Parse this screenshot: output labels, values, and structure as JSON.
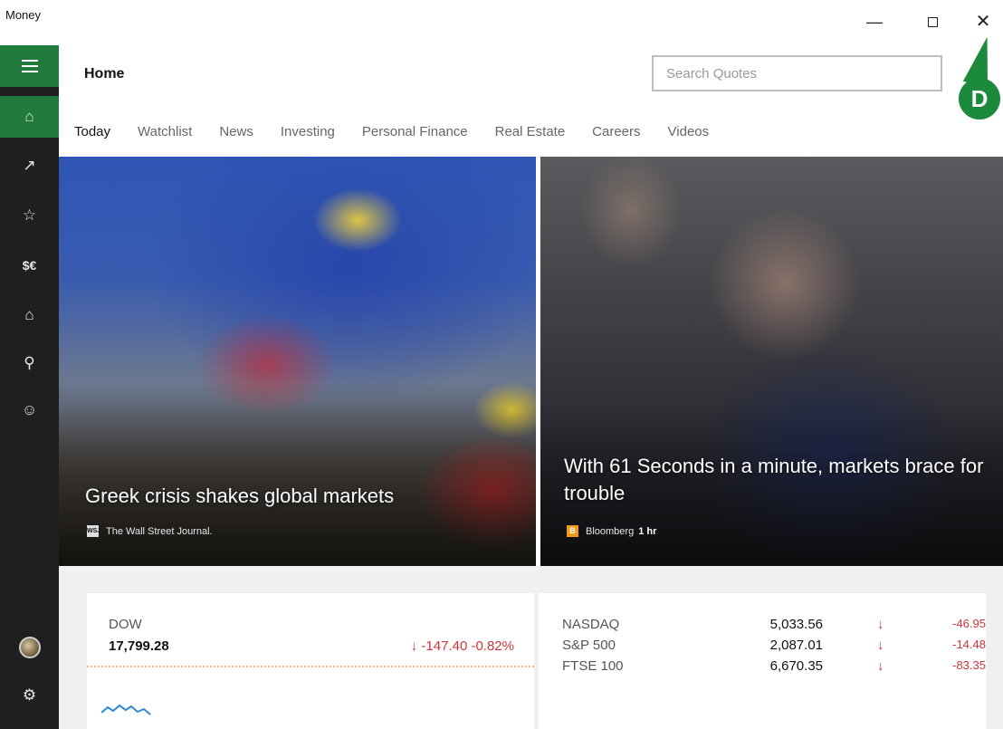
{
  "window": {
    "app_name": "Money",
    "minimize_glyph": "—",
    "close_glyph": "✕"
  },
  "rail": {
    "items": [
      {
        "name": "home",
        "icon": "home-icon",
        "glyph": "⌂"
      },
      {
        "name": "markets",
        "icon": "trend-up-icon",
        "glyph": "↗"
      },
      {
        "name": "watchlist",
        "icon": "star-icon",
        "glyph": "☆"
      },
      {
        "name": "currencies",
        "icon": "currency-icon",
        "glyph": "$€"
      },
      {
        "name": "mortgage",
        "icon": "house-dollar-icon",
        "glyph": "⌂"
      },
      {
        "name": "news",
        "icon": "news-icon",
        "glyph": "⚲"
      },
      {
        "name": "feedback",
        "icon": "smiley-icon",
        "glyph": "☺"
      },
      {
        "name": "settings",
        "icon": "gear-icon",
        "glyph": "⚙"
      }
    ]
  },
  "header": {
    "title": "Home",
    "search_placeholder": "Search Quotes"
  },
  "annotation": {
    "label": "D"
  },
  "tabs": [
    {
      "label": "Today",
      "active": true
    },
    {
      "label": "Watchlist",
      "active": false
    },
    {
      "label": "News",
      "active": false
    },
    {
      "label": "Investing",
      "active": false
    },
    {
      "label": "Personal Finance",
      "active": false
    },
    {
      "label": "Real Estate",
      "active": false
    },
    {
      "label": "Careers",
      "active": false
    },
    {
      "label": "Videos",
      "active": false
    }
  ],
  "hero": [
    {
      "headline": "Greek crisis shakes global markets",
      "source": "The Wall Street Journal.",
      "logo_text": "WSJ",
      "age": ""
    },
    {
      "headline": "With 61 Seconds in a minute, markets brace for trouble",
      "source": "Bloomberg",
      "logo_text": "B",
      "age": "1 hr"
    }
  ],
  "dow": {
    "name": "DOW",
    "value": "17,799.28",
    "change": "↓ -147.40  -0.82%"
  },
  "indices": [
    {
      "name": "NASDAQ",
      "value": "5,033.56",
      "arrow": "↓",
      "change": "-46.95"
    },
    {
      "name": "S&P 500",
      "value": "2,087.01",
      "arrow": "↓",
      "change": "-14.48"
    },
    {
      "name": "FTSE 100",
      "value": "6,670.35",
      "arrow": "↓",
      "change": "-83.35"
    }
  ],
  "colors": {
    "accent_green": "#1f7a3c",
    "rail_bg": "#1f1f1f",
    "negative_red": "#d13438",
    "callout_green": "#1b8a3a"
  }
}
